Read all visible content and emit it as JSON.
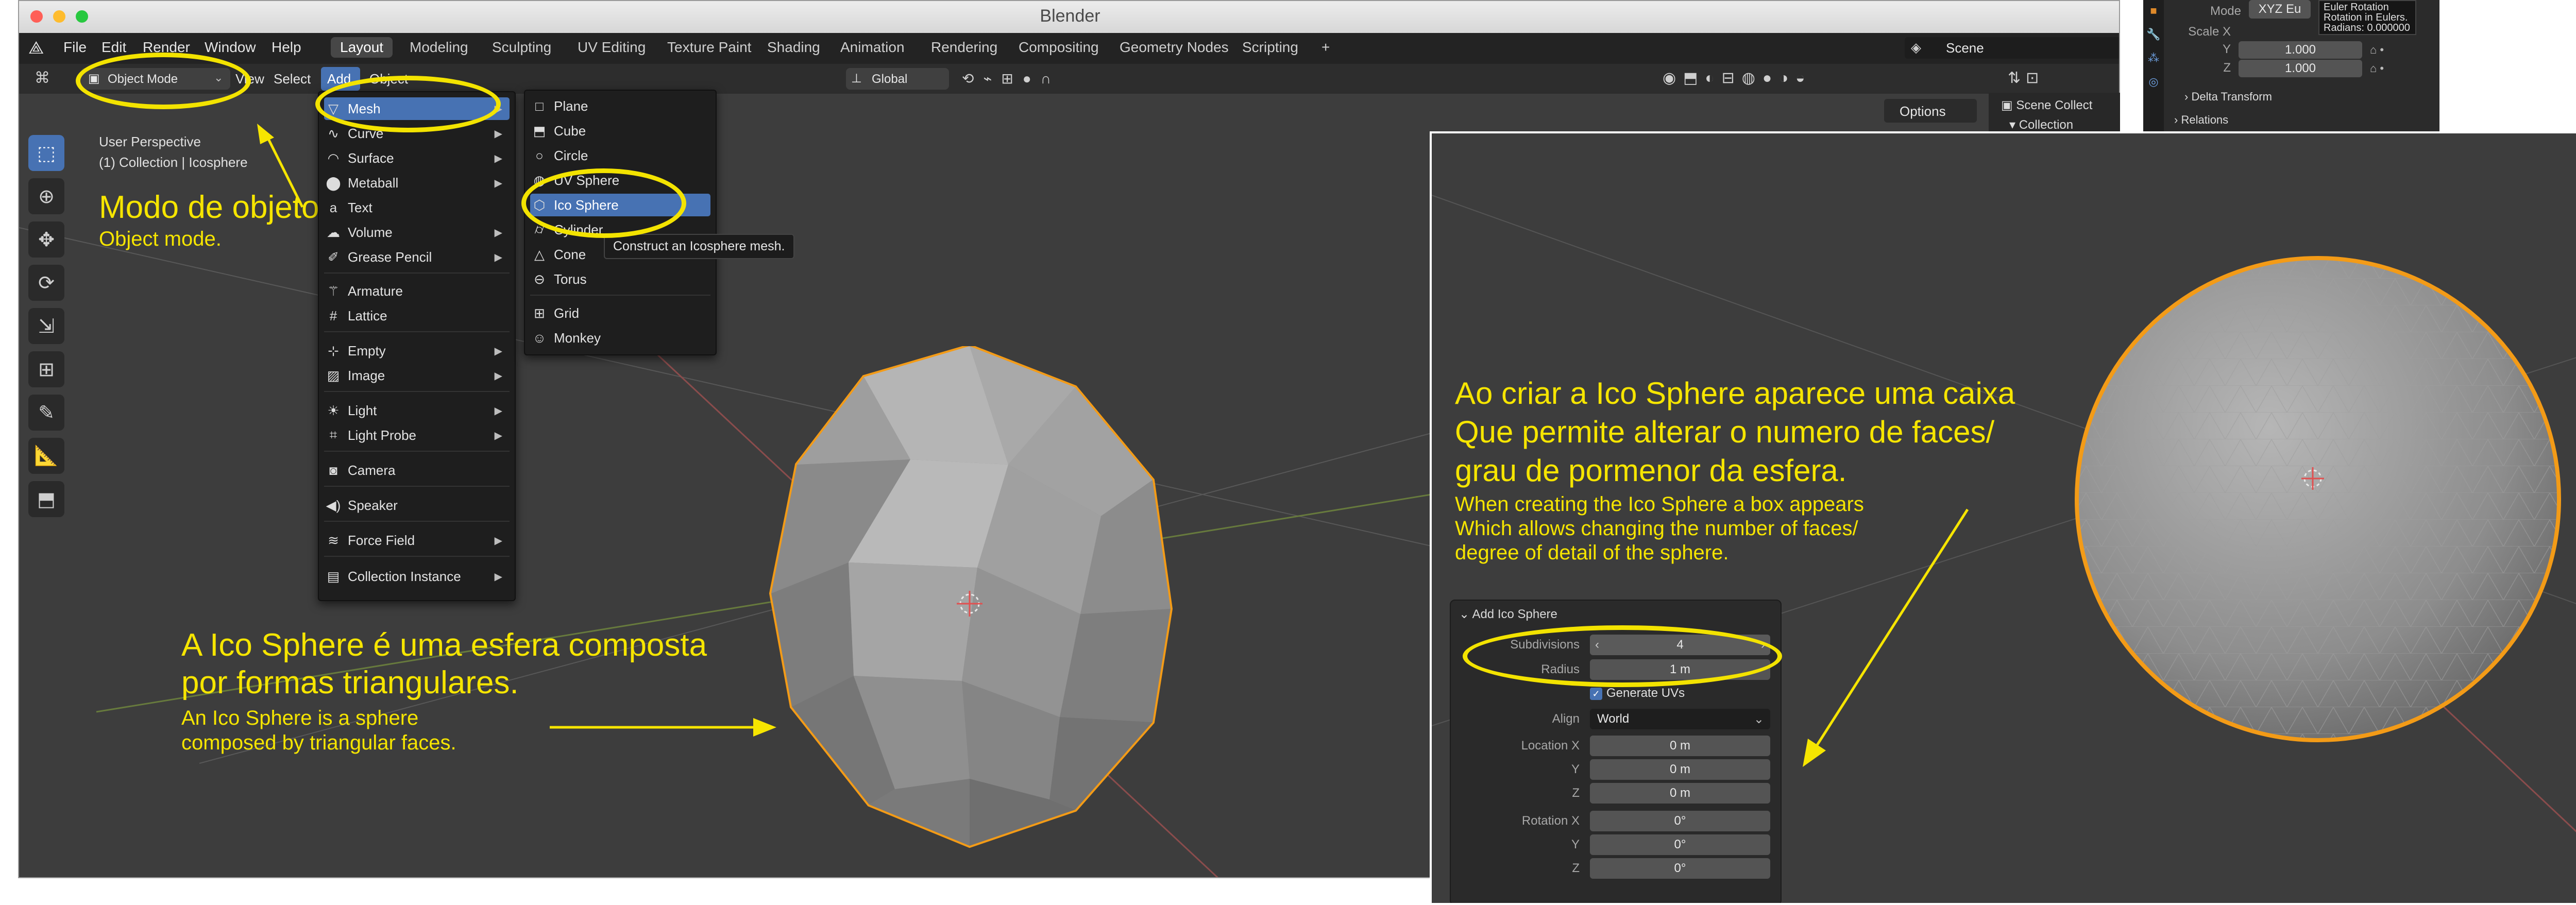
{
  "window": {
    "title": "Blender"
  },
  "menubar": {
    "items": [
      "File",
      "Edit",
      "Render",
      "Window",
      "Help"
    ]
  },
  "workspaces": [
    "Layout",
    "Modeling",
    "Sculpting",
    "UV Editing",
    "Texture Paint",
    "Shading",
    "Animation",
    "Rendering",
    "Compositing",
    "Geometry Nodes",
    "Scripting",
    "+"
  ],
  "scene": {
    "label": "Scene"
  },
  "header": {
    "mode": "Object Mode",
    "view": "View",
    "select": "Select",
    "add": "Add",
    "object": "Object",
    "orientation": "Global",
    "options": "Options"
  },
  "overlay": {
    "perspective": "User Perspective",
    "collection": "(1) Collection | Icosphere"
  },
  "add_menu": {
    "items": [
      {
        "label": "Mesh",
        "icon": "mesh-icon",
        "submenu": true
      },
      {
        "label": "Curve",
        "icon": "curve-icon",
        "submenu": true
      },
      {
        "label": "Surface",
        "icon": "surface-icon",
        "submenu": true
      },
      {
        "label": "Metaball",
        "icon": "metaball-icon",
        "submenu": true
      },
      {
        "label": "Text",
        "icon": "text-icon",
        "submenu": false
      },
      {
        "label": "Volume",
        "icon": "volume-icon",
        "submenu": true
      },
      {
        "label": "Grease Pencil",
        "icon": "grease-pencil-icon",
        "submenu": true
      },
      {
        "label": "Armature",
        "icon": "armature-icon",
        "submenu": false
      },
      {
        "label": "Lattice",
        "icon": "lattice-icon",
        "submenu": false
      },
      {
        "label": "Empty",
        "icon": "empty-icon",
        "submenu": true
      },
      {
        "label": "Image",
        "icon": "image-icon",
        "submenu": true
      },
      {
        "label": "Light",
        "icon": "light-icon",
        "submenu": true
      },
      {
        "label": "Light Probe",
        "icon": "light-probe-icon",
        "submenu": true
      },
      {
        "label": "Camera",
        "icon": "camera-icon",
        "submenu": false
      },
      {
        "label": "Speaker",
        "icon": "speaker-icon",
        "submenu": false
      },
      {
        "label": "Force Field",
        "icon": "force-field-icon",
        "submenu": true
      },
      {
        "label": "Collection Instance",
        "icon": "collection-instance-icon",
        "submenu": true
      }
    ]
  },
  "mesh_menu": {
    "items": [
      {
        "label": "Plane",
        "icon": "plane-icon"
      },
      {
        "label": "Cube",
        "icon": "cube-icon"
      },
      {
        "label": "Circle",
        "icon": "circle-icon"
      },
      {
        "label": "UV Sphere",
        "icon": "uv-sphere-icon"
      },
      {
        "label": "Ico Sphere",
        "icon": "ico-sphere-icon"
      },
      {
        "label": "Cylinder",
        "icon": "cylinder-icon"
      },
      {
        "label": "Cone",
        "icon": "cone-icon"
      },
      {
        "label": "Torus",
        "icon": "torus-icon"
      },
      {
        "label": "Grid",
        "icon": "grid-icon"
      },
      {
        "label": "Monkey",
        "icon": "monkey-icon"
      }
    ],
    "tooltip": "Construct an Icosphere mesh."
  },
  "annotations": {
    "mode_pt": "Modo de objeto",
    "mode_en": "Object mode.",
    "ico_pt_1": "A Ico Sphere é uma esfera composta",
    "ico_pt_2": "por formas triangulares.",
    "ico_en_1": "An Ico Sphere is a sphere",
    "ico_en_2": "composed by triangular faces.",
    "box_pt_1": "Ao criar a Ico Sphere aparece uma caixa",
    "box_pt_2": "Que permite alterar o numero de faces/",
    "box_pt_3": "grau de pormenor da esfera.",
    "box_en_1": "When creating the Ico Sphere a box appears",
    "box_en_2": "Which allows changing the number of faces/",
    "box_en_3": "degree of detail of the sphere."
  },
  "operator_panel": {
    "title": "Add Ico Sphere",
    "subdivisions_label": "Subdivisions",
    "subdivisions": "4",
    "radius_label": "Radius",
    "radius": "1 m",
    "generate_uvs": "Generate UVs",
    "align_label": "Align",
    "align": "World",
    "location_x_label": "Location X",
    "location_x": "0 m",
    "location_y_label": "Y",
    "location_y": "0 m",
    "location_z_label": "Z",
    "location_z": "0 m",
    "rotation_x_label": "Rotation X",
    "rotation_x": "0°",
    "rotation_y_label": "Y",
    "rotation_y": "0°",
    "rotation_z_label": "Z",
    "rotation_z": "0°"
  },
  "right_panel": {
    "mode_label": "Mode",
    "mode_value": "XYZ Eu",
    "tooltip_1": "Euler Rotation",
    "tooltip_2": "Rotation in Eulers.",
    "tooltip_3": "Radians: 0.000000",
    "scale_x_label": "Scale X",
    "scale_y_label": "Y",
    "scale_y": "1.000",
    "scale_z_label": "Z",
    "scale_z": "1.000",
    "delta_transform": "Delta Transform",
    "relations": "Relations",
    "outliner_scene_collection": "Scene Collect",
    "outliner_collection": "Collection"
  },
  "colors": {
    "selection_orange": "#f39b17",
    "annotation_yellow": "#f6e500",
    "highlight_blue": "#4772b3"
  }
}
